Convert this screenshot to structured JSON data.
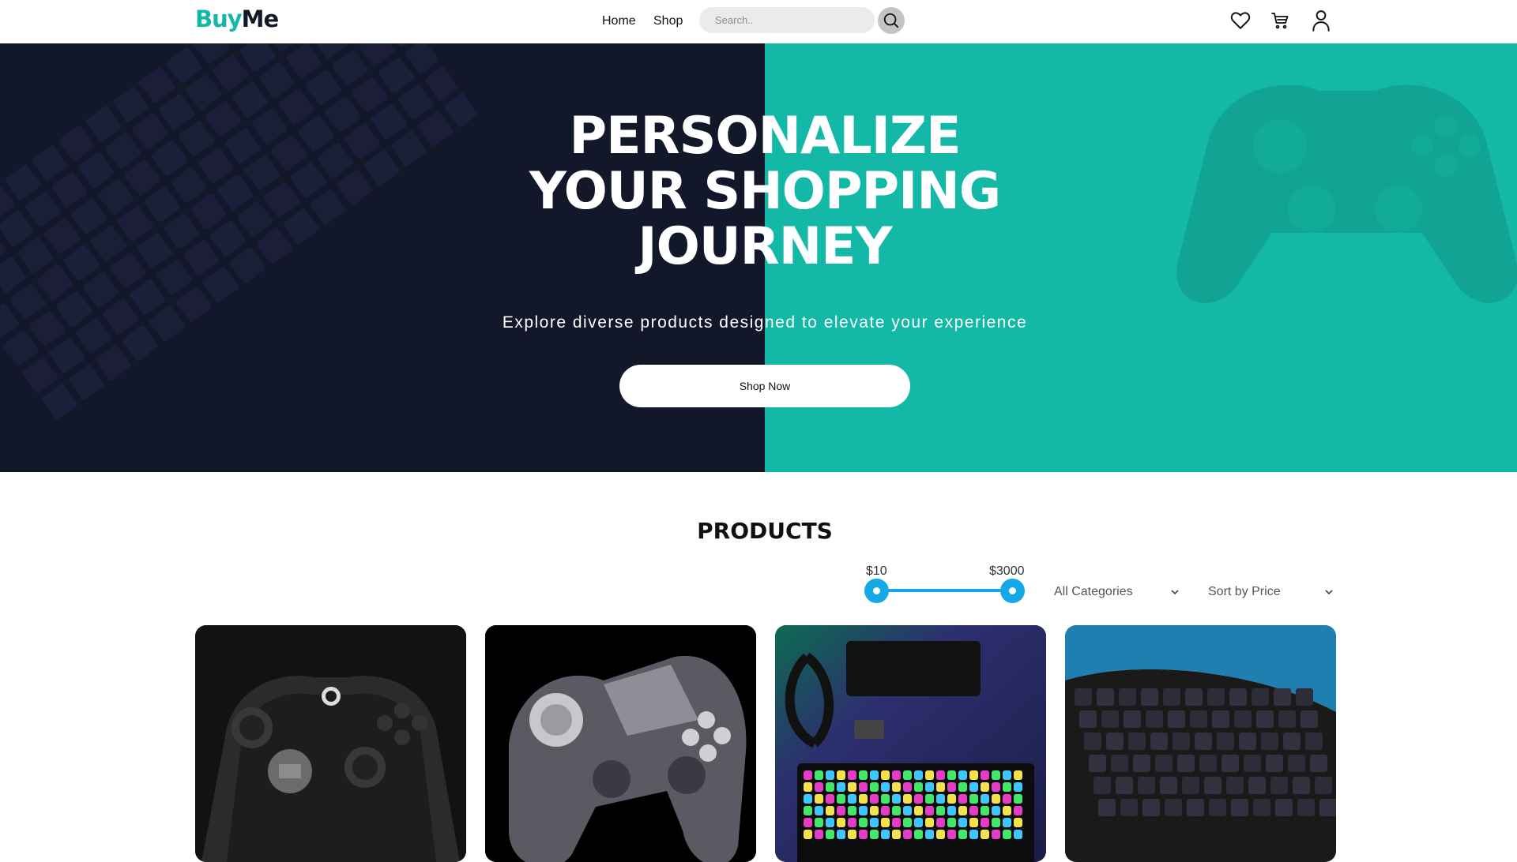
{
  "brand": {
    "part1": "Buy",
    "part2": "Me"
  },
  "nav": {
    "home": "Home",
    "shop": "Shop"
  },
  "search": {
    "placeholder": "Search.."
  },
  "hero": {
    "title_line1": "PERSONALIZE",
    "title_line2": "YOUR SHOPPING",
    "title_line3": "JOURNEY",
    "subtitle": "Explore diverse products designed to elevate your experience",
    "cta": "Shop Now"
  },
  "products": {
    "title": "PRODUCTS",
    "price_min": "$10",
    "price_max": "$3000",
    "category_select": "All Categories",
    "sort_select": "Sort by Price",
    "cards": [
      {
        "image": "xbox-elite-controller"
      },
      {
        "image": "ps4-dualshock-controller"
      },
      {
        "image": "rgb-mechanical-keyboard-desk"
      },
      {
        "image": "logitech-rgb-keyboard"
      }
    ]
  },
  "colors": {
    "accent": "#14b8a6",
    "dark": "#12172a",
    "slider": "#14a8e6"
  },
  "icons": [
    "search-icon",
    "heart-icon",
    "cart-icon",
    "user-icon",
    "chevron-down-icon"
  ]
}
